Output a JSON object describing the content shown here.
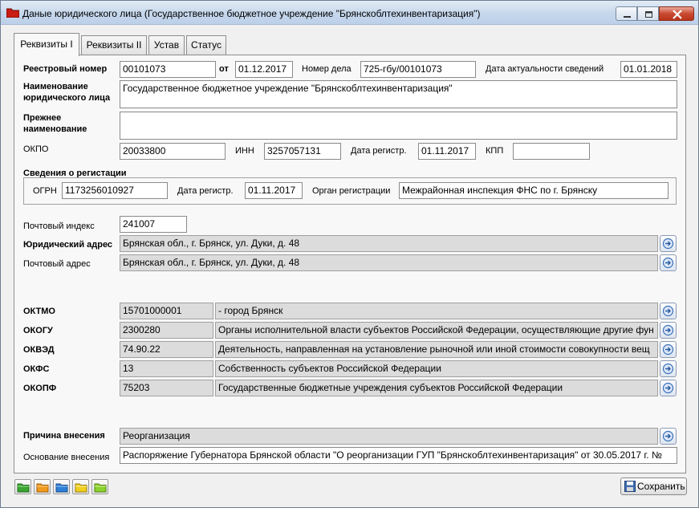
{
  "window": {
    "title": "Даные юридического лица (Государственное бюджетное учреждение \"Брянскоблтехинвентаризация\")"
  },
  "tabs": [
    {
      "label": "Реквизиты I",
      "active": true
    },
    {
      "label": "Реквизиты II",
      "active": false
    },
    {
      "label": "Устав",
      "active": false
    },
    {
      "label": "Статус",
      "active": false
    }
  ],
  "main": {
    "reg_number": {
      "label": "Реестровый номер",
      "value": "00101073"
    },
    "from": {
      "label": "от",
      "value": "01.12.2017"
    },
    "case_number": {
      "label": "Номер дела",
      "value": "725-гбу/00101073"
    },
    "actual_date": {
      "label": "Дата актуальности сведений",
      "value": "01.01.2018"
    },
    "name": {
      "label": "Наименование юридического лица",
      "value": "Государственное бюджетное учреждение \"Брянскоблтехинвентаризация\""
    },
    "prev_name": {
      "label": "Прежнее наименование",
      "value": ""
    },
    "okpo": {
      "label": "ОКПО",
      "value": "20033800"
    },
    "inn": {
      "label": "ИНН",
      "value": "3257057131"
    },
    "reg_date": {
      "label": "Дата регистр.",
      "value": "01.11.2017"
    },
    "kpp": {
      "label": "КПП",
      "value": ""
    }
  },
  "registration": {
    "title": "Сведения о регистации",
    "ogrn": {
      "label": "ОГРН",
      "value": "1173256010927"
    },
    "reg_date": {
      "label": "Дата регистр.",
      "value": "01.11.2017"
    },
    "authority": {
      "label": "Орган регистрации",
      "value": "Межрайонная инспекция ФНС по г. Брянску"
    }
  },
  "address": {
    "postal_index": {
      "label": "Почтовый индекс",
      "value": "241007"
    },
    "legal": {
      "label": "Юридический адрес",
      "value": "Брянская обл., г. Брянск, ул. Дуки, д. 48"
    },
    "postal": {
      "label": "Почтовый адрес",
      "value": "Брянская обл., г. Брянск, ул. Дуки, д. 48"
    }
  },
  "classifiers": [
    {
      "label": "ОКТМО",
      "code": "15701000001",
      "text": "- город Брянск"
    },
    {
      "label": "ОКОГУ",
      "code": "2300280",
      "text": "Органы исполнительной власти субъектов Российской Федерации, осуществляющие другие фун"
    },
    {
      "label": "ОКВЭД",
      "code": "74.90.22",
      "text": "Деятельность, направленная на установление рыночной или иной стоимости совокупности вещ"
    },
    {
      "label": "ОКФС",
      "code": "13",
      "text": "Собственность субъектов Российской Федерации"
    },
    {
      "label": "ОКОПФ",
      "code": "75203",
      "text": "Государственные бюджетные учреждения субъектов Российской Федерации"
    }
  ],
  "reason": {
    "label": "Причина внесения",
    "value": "Реорганизация"
  },
  "basis": {
    "label": "Основание внесения",
    "value": "Распоряжение Губернатора Брянской области \"О реорганизации ГУП \"Брянскоблтехинвентаризация\" от 30.05.2017 г. №"
  },
  "footer": {
    "save_label": "Сохранить"
  },
  "colors": {
    "folder_green": "#3aa532",
    "folder_orange": "#f09a1c",
    "folder_blue": "#2e7fd6",
    "folder_yellow": "#f2cf1f",
    "folder_lime": "#8cd12e"
  }
}
